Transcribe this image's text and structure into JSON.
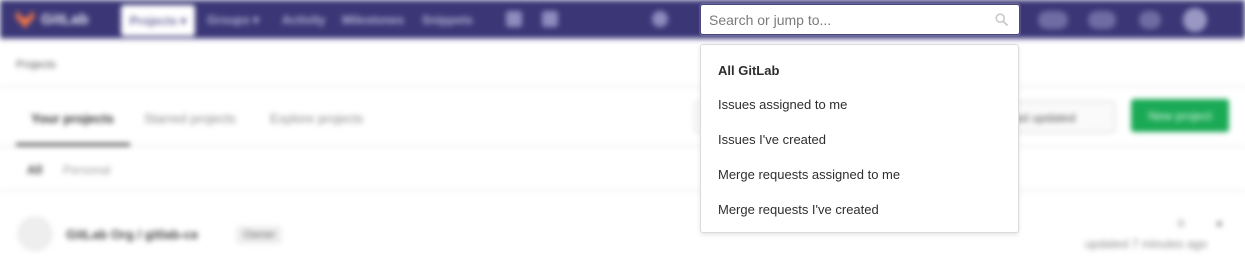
{
  "navbar": {
    "brand": "GitLab",
    "projects_label": "Projects ▾",
    "groups_label": "Groups ▾",
    "activity_label": "Activity",
    "milestones_label": "Milestones",
    "snippets_label": "Snippets"
  },
  "search": {
    "value": "",
    "placeholder": "Search or jump to..."
  },
  "dropdown": {
    "header": "All GitLab",
    "items": [
      "Issues assigned to me",
      "Issues I've created",
      "Merge requests assigned to me",
      "Merge requests I've created"
    ]
  },
  "page": {
    "breadcrumb": "Projects",
    "tabs": [
      "Your projects",
      "Starred projects",
      "Explore projects"
    ],
    "sort_label": "Last updated",
    "new_project_label": "New project",
    "subtabs": [
      "All",
      "Personal"
    ],
    "project": {
      "name": "GitLab Org / gitlab-ce",
      "badge": "Owner",
      "stars": "0",
      "updated": "updated 7 minutes ago"
    }
  },
  "colors": {
    "navbar": "#3b3777",
    "accent_green": "#1aaa55",
    "text": "#2e2e2e"
  }
}
